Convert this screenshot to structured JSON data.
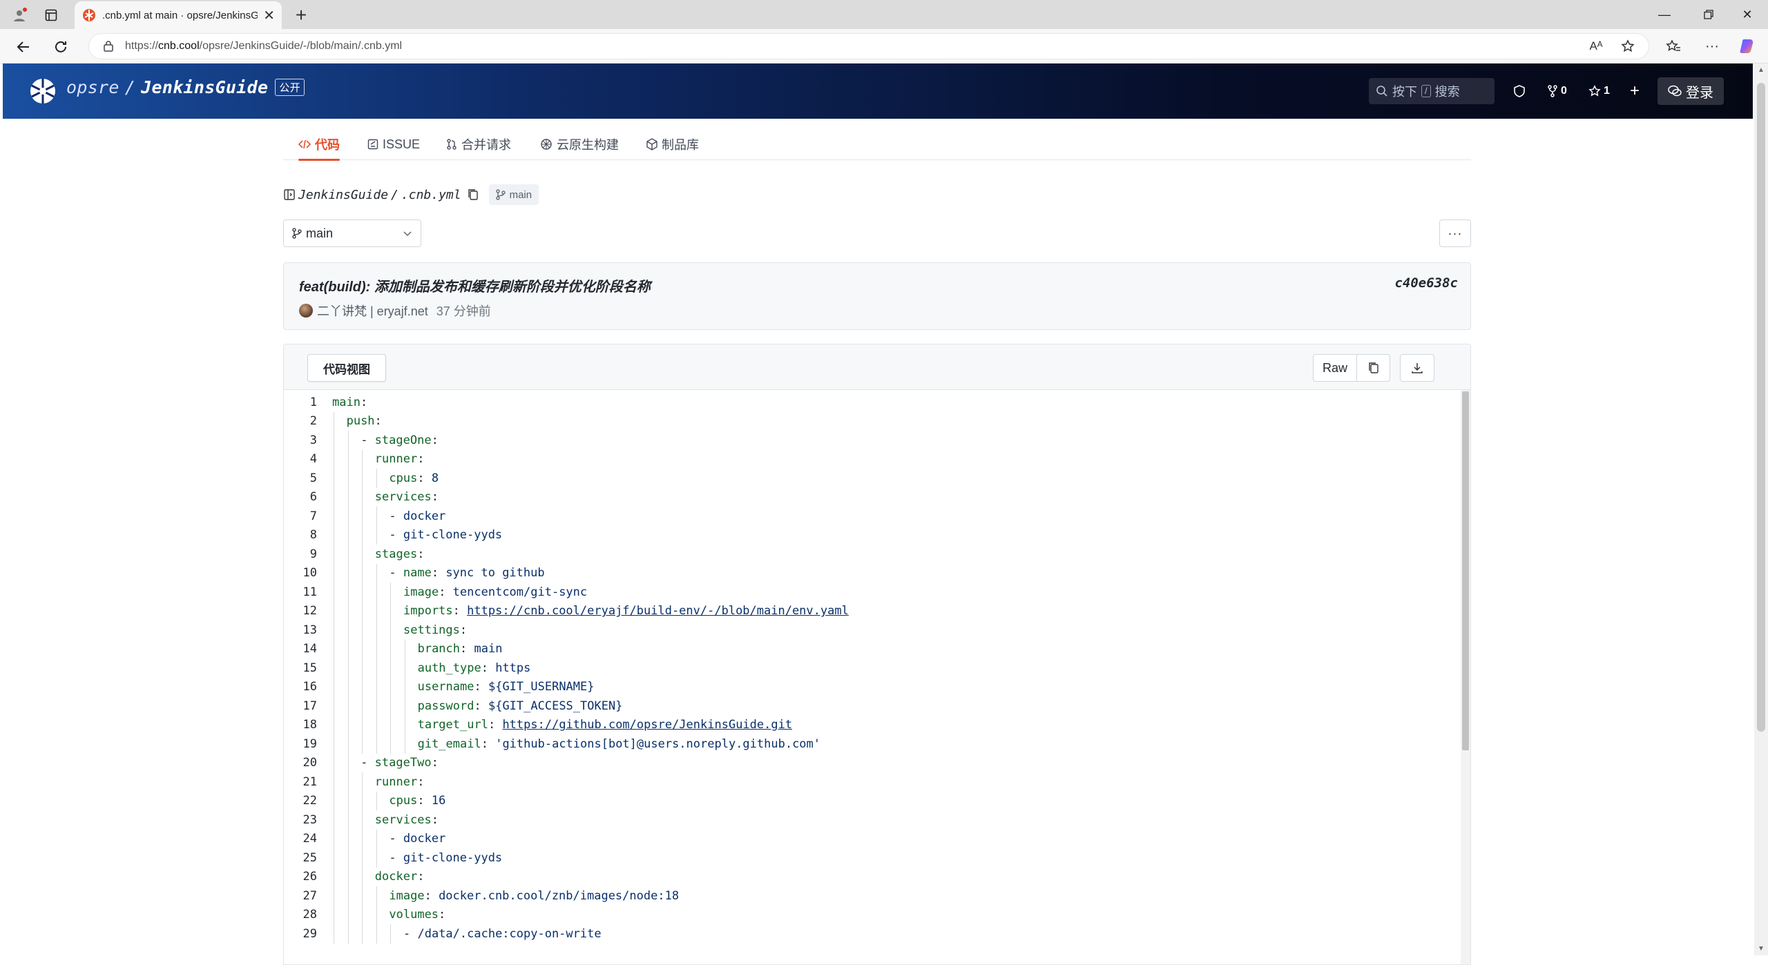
{
  "browser": {
    "tab_title": ".cnb.yml at main · opsre/JenkinsGuide",
    "url_prefix": "https://",
    "url_host": "cnb.cool",
    "url_path": "/opsre/JenkinsGuide/-/blob/main/.cnb.yml"
  },
  "header": {
    "owner": "opsre",
    "separator": "/",
    "repo": "JenkinsGuide",
    "visibility": "公开",
    "search_prefix": "按下",
    "search_key": "/",
    "search_label": "搜索",
    "fork_count": "0",
    "star_count": "1",
    "login_label": "登录"
  },
  "tabs": [
    {
      "label": "代码",
      "icon": "code-icon"
    },
    {
      "label": "ISSUE",
      "icon": "issue-icon"
    },
    {
      "label": "合并请求",
      "icon": "merge-icon"
    },
    {
      "label": "云原生构建",
      "icon": "build-icon"
    },
    {
      "label": "制品库",
      "icon": "package-icon"
    }
  ],
  "breadcrumb": {
    "repo": "JenkinsGuide",
    "separator": "/",
    "file": ".cnb.yml",
    "branch": "main"
  },
  "branch_select": {
    "value": "main"
  },
  "more_label": "···",
  "commit": {
    "message": "feat(build): 添加制品发布和缓存刷新阶段并优化阶段名称",
    "sha": "c40e638c",
    "author": "二丫讲梵 | eryajf.net",
    "time": "37 分钟前"
  },
  "code_toolbar": {
    "view_label": "代码视图",
    "raw_label": "Raw"
  },
  "code_lines": [
    {
      "n": "1",
      "indent": 0,
      "key": "main",
      "sep": ":",
      "val": ""
    },
    {
      "n": "2",
      "indent": 1,
      "key": "push",
      "sep": ":",
      "val": ""
    },
    {
      "n": "3",
      "indent": 2,
      "dash": true,
      "key": "stageOne",
      "sep": ":",
      "val": ""
    },
    {
      "n": "4",
      "indent": 3,
      "key": "runner",
      "sep": ":",
      "val": ""
    },
    {
      "n": "5",
      "indent": 4,
      "key": "cpus",
      "sep": ": ",
      "val": "8"
    },
    {
      "n": "6",
      "indent": 3,
      "key": "services",
      "sep": ":",
      "val": ""
    },
    {
      "n": "7",
      "indent": 4,
      "dash": true,
      "key": "",
      "sep": "",
      "val": "docker"
    },
    {
      "n": "8",
      "indent": 4,
      "dash": true,
      "key": "",
      "sep": "",
      "val": "git-clone-yyds"
    },
    {
      "n": "9",
      "indent": 3,
      "key": "stages",
      "sep": ":",
      "val": ""
    },
    {
      "n": "10",
      "indent": 4,
      "dash": true,
      "key": "name",
      "sep": ": ",
      "val": "sync to github"
    },
    {
      "n": "11",
      "indent": 5,
      "key": "image",
      "sep": ": ",
      "val": "tencentcom/git-sync"
    },
    {
      "n": "12",
      "indent": 5,
      "key": "imports",
      "sep": ": ",
      "val": "https://cnb.cool/eryajf/build-env/-/blob/main/env.yaml",
      "link": true
    },
    {
      "n": "13",
      "indent": 5,
      "key": "settings",
      "sep": ":",
      "val": ""
    },
    {
      "n": "14",
      "indent": 6,
      "key": "branch",
      "sep": ": ",
      "val": "main"
    },
    {
      "n": "15",
      "indent": 6,
      "key": "auth_type",
      "sep": ": ",
      "val": "https"
    },
    {
      "n": "16",
      "indent": 6,
      "key": "username",
      "sep": ": ",
      "val": "${GIT_USERNAME}"
    },
    {
      "n": "17",
      "indent": 6,
      "key": "password",
      "sep": ": ",
      "val": "${GIT_ACCESS_TOKEN}"
    },
    {
      "n": "18",
      "indent": 6,
      "key": "target_url",
      "sep": ": ",
      "val": "https://github.com/opsre/JenkinsGuide.git",
      "link": true
    },
    {
      "n": "19",
      "indent": 6,
      "key": "git_email",
      "sep": ": ",
      "val": "'github-actions[bot]@users.noreply.github.com'"
    },
    {
      "n": "20",
      "indent": 2,
      "dash": true,
      "key": "stageTwo",
      "sep": ":",
      "val": ""
    },
    {
      "n": "21",
      "indent": 3,
      "key": "runner",
      "sep": ":",
      "val": ""
    },
    {
      "n": "22",
      "indent": 4,
      "key": "cpus",
      "sep": ": ",
      "val": "16"
    },
    {
      "n": "23",
      "indent": 3,
      "key": "services",
      "sep": ":",
      "val": ""
    },
    {
      "n": "24",
      "indent": 4,
      "dash": true,
      "key": "",
      "sep": "",
      "val": "docker"
    },
    {
      "n": "25",
      "indent": 4,
      "dash": true,
      "key": "",
      "sep": "",
      "val": "git-clone-yyds"
    },
    {
      "n": "26",
      "indent": 3,
      "key": "docker",
      "sep": ":",
      "val": ""
    },
    {
      "n": "27",
      "indent": 4,
      "key": "image",
      "sep": ": ",
      "val": "docker.cnb.cool/znb/images/node:18"
    },
    {
      "n": "28",
      "indent": 4,
      "key": "volumes",
      "sep": ":",
      "val": ""
    },
    {
      "n": "29",
      "indent": 5,
      "dash": true,
      "key": "",
      "sep": "",
      "val": "/data/.cache:copy-on-write"
    }
  ]
}
